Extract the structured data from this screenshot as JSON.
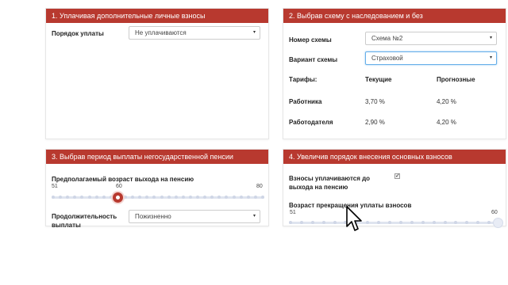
{
  "panels": {
    "p1": {
      "title": "1. Уплачивая дополнительные личные взносы",
      "order_label": "Порядок уплаты",
      "order_value": "Не уплачиваются"
    },
    "p2": {
      "title": "2. Выбрав схему с наследованием и без",
      "scheme_label": "Номер схемы",
      "scheme_value": "Схема №2",
      "variant_label": "Вариант схемы",
      "variant_value": "Страховой",
      "tariffs_label": "Тарифы:",
      "col_current": "Текущие",
      "col_forecast": "Прогнозные",
      "rows": [
        {
          "label": "Работника",
          "current": "3,70 %",
          "forecast": "4,20 %"
        },
        {
          "label": "Работодателя",
          "current": "2,90 %",
          "forecast": "4,20 %"
        }
      ]
    },
    "p3": {
      "title": "3. Выбрав период выплаты негосударственной пенсии",
      "age_label": "Предполагаемый возраст выхода на пенсию",
      "slider_min": "51",
      "slider_value": "60",
      "slider_max": "80",
      "slider_fraction": 0.31,
      "duration_label_1": "Продолжительность",
      "duration_label_2": "выплаты",
      "duration_value": "Пожизненно"
    },
    "p4": {
      "title": "4. Увеличив порядок внесения основных взносов",
      "pay_label_1": "Взносы уплачиваются до",
      "pay_label_2": "выхода на пенсию",
      "pay_checked": true,
      "stop_age_label": "Возраст прекращения уплаты взносов",
      "slider_min": "51",
      "slider_max": "60",
      "slider_fraction": 1.0
    }
  },
  "icons": {
    "caret": "▾",
    "check": "✓"
  },
  "colors": {
    "accent": "#b8392f",
    "track": "#dfe4ef"
  }
}
